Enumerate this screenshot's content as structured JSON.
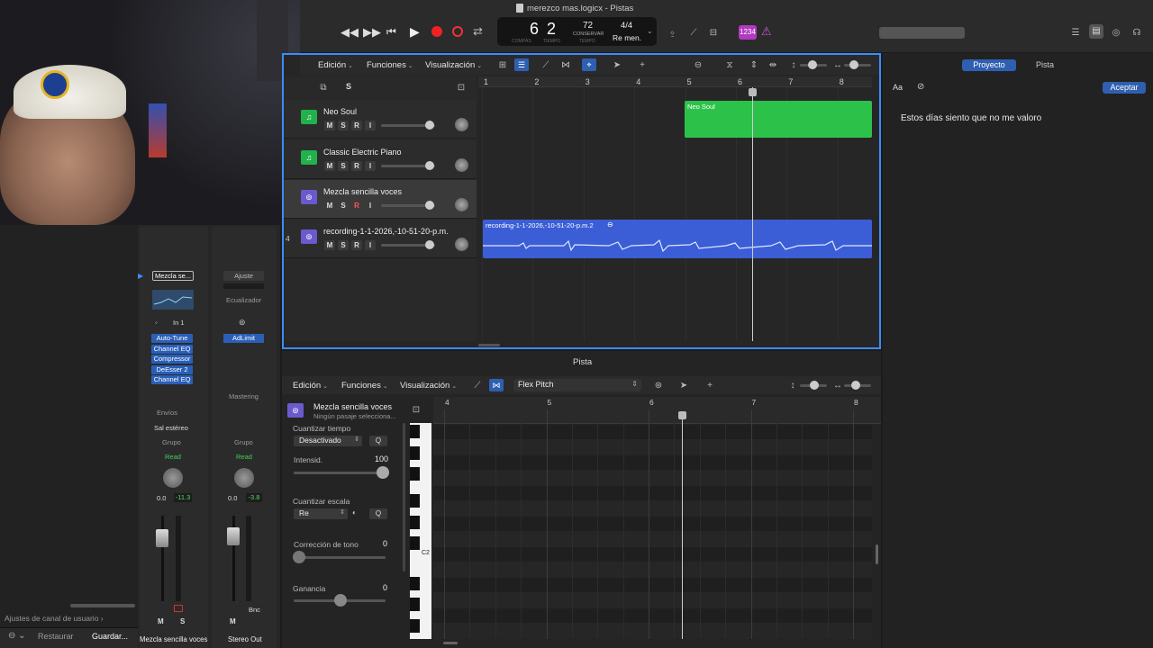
{
  "window": {
    "title": "merezco mas.logicx - Pistas"
  },
  "transport": {
    "bar": "6",
    "beat": "2",
    "bar_label": "COMPÁS",
    "beat_label": "TIEMPO",
    "tempo": "72",
    "tempo_mode": "CONSERVAR",
    "tempo_label": "TEMPO",
    "time_sig": "4/4",
    "key": "Re men.",
    "count_in": "1234"
  },
  "toolbar": {
    "edit": "Edición",
    "functions": "Funciones",
    "view": "Visualización"
  },
  "tracks_header": {
    "s_button": "S"
  },
  "ruler": [
    "1",
    "2",
    "3",
    "4",
    "5",
    "6",
    "7",
    "8"
  ],
  "tracks": [
    {
      "name": "Neo Soul",
      "m": "M",
      "s": "S",
      "r": "R",
      "i": "I",
      "color": "#22b14c"
    },
    {
      "name": "Classic Electric Piano",
      "m": "M",
      "s": "S",
      "r": "R",
      "i": "I",
      "color": "#22b14c"
    },
    {
      "name": "Mezcla sencilla voces",
      "m": "M",
      "s": "S",
      "r": "R",
      "i": "I",
      "color": "#6a5acd"
    },
    {
      "name": "recording-1-1-2026,-10-51-20-p.m.",
      "m": "M",
      "s": "S",
      "r": "R",
      "i": "I",
      "num": "4",
      "color": "#6a5acd"
    }
  ],
  "regions": {
    "neo_soul": "Neo Soul",
    "recording": "recording-1-1-2026,-10-51-20-p.m.2"
  },
  "inspector": {
    "tab_project": "Proyecto",
    "tab_track": "Pista",
    "font_button": "Aa",
    "accept": "Aceptar",
    "note_text": "Estos días siento que no me valoro"
  },
  "channel_strips": {
    "left": {
      "setting": "Mezcla se...",
      "input": "In 1",
      "plugins": [
        "Auto-Tune",
        "Channel EQ",
        "Compressor",
        "DeEsser 2",
        "Channel EQ"
      ],
      "sends": "Envíos",
      "output": "Sal estéreo",
      "group": "Grupo",
      "automation": "Read",
      "pan": "0.0",
      "gain": "-11.3",
      "m": "M",
      "s": "S",
      "name": "Mezcla sencilla voces"
    },
    "right": {
      "setting": "Ajuste",
      "eq": "Ecualizador",
      "plugin": "AdLimit",
      "mastering": "Mastering",
      "group": "Grupo",
      "automation": "Read",
      "pan": "0.0",
      "gain": "-3.8",
      "m": "M",
      "bnc": "Bnc",
      "name": "Stereo Out"
    },
    "user_settings": "Ajustes de canal de usuario",
    "restore": "Restaurar",
    "save": "Guardar..."
  },
  "editor": {
    "title": "Pista",
    "edit": "Edición",
    "functions": "Funciones",
    "view": "Visualización",
    "mode": "Flex Pitch",
    "track_name": "Mezcla sencilla voces",
    "track_sub": "Ningún pasaje selecciona...",
    "quantize_time": "Cuantizar tiempo",
    "quantize_value": "Desactivado",
    "q": "Q",
    "intensity": "Intensid.",
    "intensity_value": "100",
    "quantize_scale": "Cuantizar escala",
    "scale_value": "Re",
    "pitch_correction": "Corrección de tono",
    "pitch_value": "0",
    "gain": "Ganancia",
    "gain_value": "0",
    "c2": "C2",
    "ruler": [
      "4",
      "5",
      "6",
      "7",
      "8"
    ]
  }
}
